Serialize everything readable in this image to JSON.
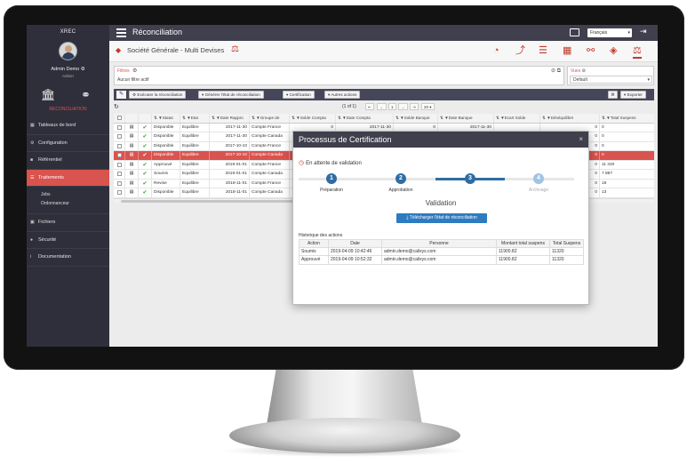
{
  "app": {
    "name": "XREC",
    "page_title": "Réconciliation",
    "company": "Société Générale - Multi Devises"
  },
  "user": {
    "name": "Admin Demo",
    "role": "Admin"
  },
  "module_label": "RECONCILIATION",
  "sidebar": {
    "items": [
      {
        "label": "Tableaux de bord",
        "icon": "dashboard-icon"
      },
      {
        "label": "Configuration",
        "icon": "gear-icon"
      },
      {
        "label": "Référentiel",
        "icon": "folder-icon"
      },
      {
        "label": "Traitements",
        "icon": "list-icon"
      },
      {
        "label": "Fichiers",
        "icon": "file-icon"
      },
      {
        "label": "Sécurité",
        "icon": "users-icon"
      },
      {
        "label": "Documentation",
        "icon": "info-icon"
      }
    ],
    "sub_items": [
      "Jobs",
      "Ordonnanceur"
    ]
  },
  "topbar": {
    "language": "Français"
  },
  "filters": {
    "label": "Filtres",
    "value": "Aucun filtre actif"
  },
  "view": {
    "label": "Vues",
    "value": "Default"
  },
  "actions": {
    "execute": "Exécuter la réconciliation",
    "generate": "Générer l'état de réconciliation",
    "certification": "Certification",
    "other": "Autres actions",
    "export": "Exporter"
  },
  "pager": {
    "info": "(1 of 1)",
    "current_page": "1",
    "page_size": "20"
  },
  "grid": {
    "columns": [
      "Statut",
      "Etat",
      "Date Rappro",
      "Groupe de",
      "Solde Compta",
      "Date Compta",
      "Solde Banque",
      "Date Banque",
      "Ecart Solde",
      "Déséquilibre",
      "Total Suspens"
    ],
    "rows": [
      [
        "Disponible",
        "Equilibre",
        "2017-11-30",
        "Compte France",
        "0",
        "2017-11-30",
        "0",
        "2017-11-30",
        "",
        "0",
        "0"
      ],
      [
        "Disponible",
        "Equilibre",
        "2017-11-30",
        "Compte Canada",
        "",
        "",
        "",
        "",
        "",
        "0",
        "0"
      ],
      [
        "Disponible",
        "Equilibre",
        "2017-10-10",
        "Compte France",
        "",
        "",
        "",
        "",
        "",
        "0",
        "0"
      ],
      [
        "Disponible",
        "Equilibre",
        "2017-10-10",
        "Compte Canada",
        "",
        "",
        "",
        "",
        "",
        "0",
        "0"
      ],
      [
        "Approuvé",
        "Equilibre",
        "2019-01-01",
        "Compte France",
        "",
        "",
        "",
        "",
        "",
        "0",
        "11 320"
      ],
      [
        "Soumis",
        "Equilibre",
        "2019-01-01",
        "Compte Canada",
        "",
        "",
        "",
        "",
        "",
        "0",
        "7 887"
      ],
      [
        "Revise",
        "Equilibre",
        "2018-11-01",
        "Compte France",
        "",
        "",
        "",
        "",
        "",
        "0",
        "18"
      ],
      [
        "Disponible",
        "Equilibre",
        "2018-11-01",
        "Compte Canada",
        "",
        "",
        "",
        "",
        "",
        "0",
        "13"
      ]
    ],
    "selected_row_index": 3
  },
  "modal": {
    "title": "Processus de Certification",
    "status": "En attente de validation",
    "steps": [
      {
        "number": "1",
        "label": "Préparation"
      },
      {
        "number": "2",
        "label": "Approbation"
      },
      {
        "number": "3",
        "label": "Validation"
      },
      {
        "number": "4",
        "label": "Archivage"
      }
    ],
    "current_step": "Validation",
    "download_label": "Télécharger l'état de réconciliation",
    "history_title": "Historique des actions",
    "history_columns": [
      "Action",
      "Date",
      "Personne",
      "Montant total suspens",
      "Total Suspens"
    ],
    "history": [
      [
        "Soumis",
        "2019-04-09 10:42:46",
        "admin.demo@calixys.com",
        "11900.82",
        "11320"
      ],
      [
        "Approuvé",
        "2019-04-09 10:52:32",
        "admin.demo@calixys.com",
        "11900.82",
        "11320"
      ]
    ]
  },
  "colors": {
    "accent": "#d9534f",
    "sidebar": "#2f2f3c",
    "header": "#3f3f4d",
    "step": "#2f6da3"
  }
}
